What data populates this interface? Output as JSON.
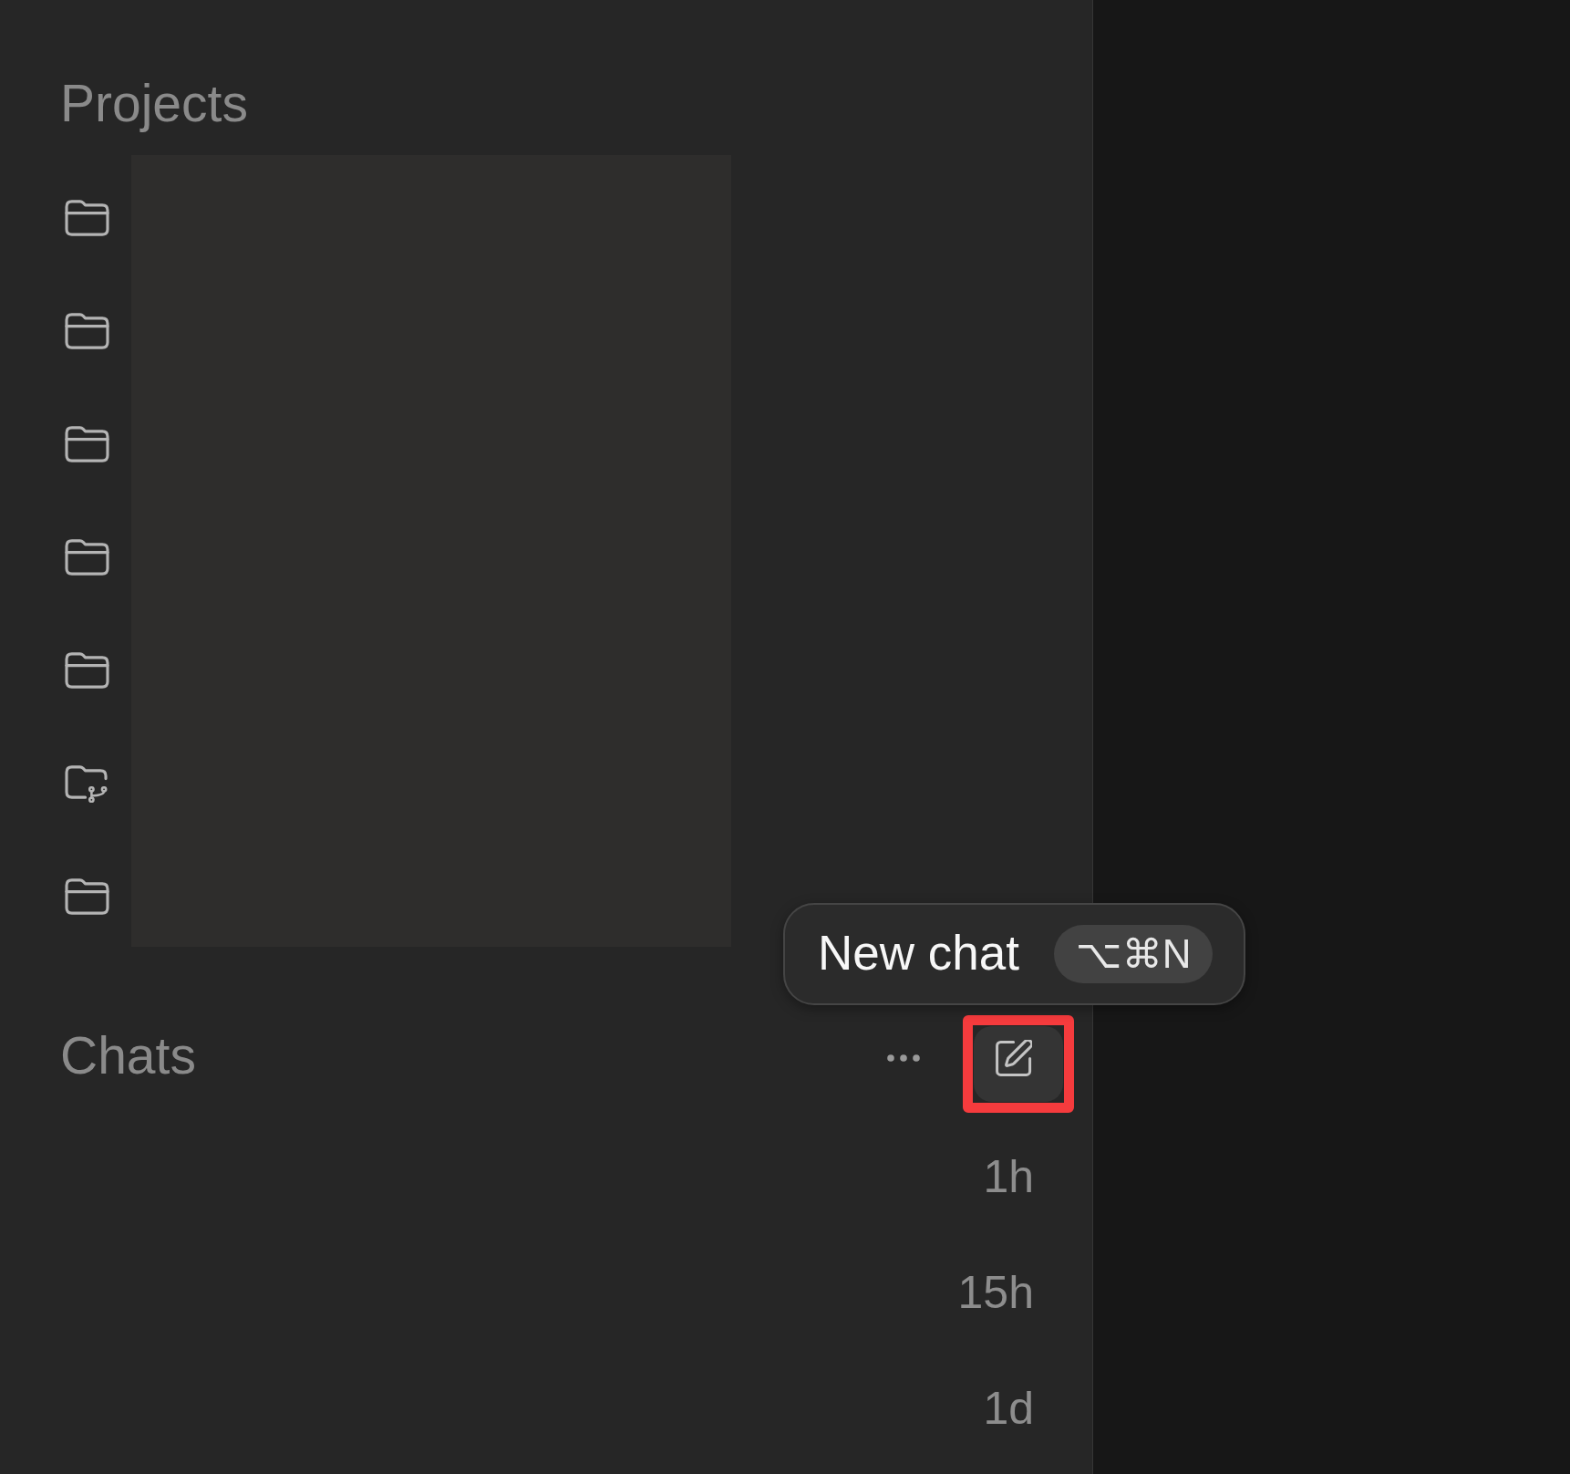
{
  "sidebar": {
    "projects": {
      "title": "Projects",
      "names_redacted": true,
      "items": [
        {
          "kind": "folder"
        },
        {
          "kind": "folder"
        },
        {
          "kind": "folder"
        },
        {
          "kind": "folder"
        },
        {
          "kind": "folder"
        },
        {
          "kind": "branch-folder"
        },
        {
          "kind": "folder"
        }
      ]
    },
    "chats": {
      "title": "Chats",
      "new_chat_button": {
        "highlighted": true,
        "tooltip": {
          "label": "New chat",
          "shortcut": "⌥⌘N"
        }
      },
      "items": [
        {
          "time": "1h"
        },
        {
          "time": "15h"
        },
        {
          "time": "1d"
        }
      ]
    }
  }
}
